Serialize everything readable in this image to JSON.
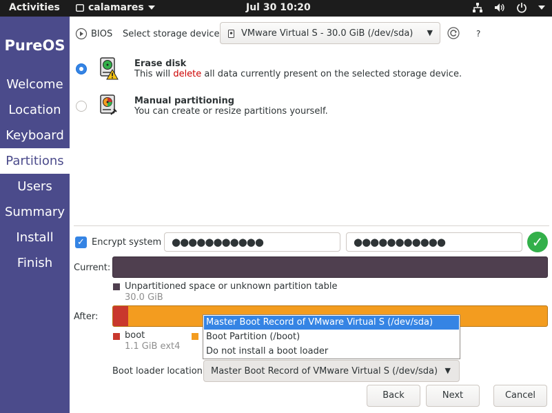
{
  "topbar": {
    "activities": "Activities",
    "app_name": "calamares",
    "clock": "Jul 30  10:20",
    "icons": [
      "network-icon",
      "volume-icon",
      "power-icon",
      "chevron-down-icon"
    ]
  },
  "sidebar": {
    "logo": "PureOS",
    "steps": [
      {
        "label": "Welcome"
      },
      {
        "label": "Location"
      },
      {
        "label": "Keyboard"
      },
      {
        "label": "Partitions",
        "active": true
      },
      {
        "label": "Users"
      },
      {
        "label": "Summary"
      },
      {
        "label": "Install"
      },
      {
        "label": "Finish"
      }
    ]
  },
  "device": {
    "firmware": "BIOS",
    "label": "Select storage device:",
    "selected": "VMware Virtual S - 30.0 GiB (/dev/sda)",
    "help": "?"
  },
  "options": {
    "erase": {
      "title": "Erase disk",
      "desc_pre": "This will ",
      "desc_red": "delete",
      "desc_post": " all data currently present on the selected storage device.",
      "selected": true
    },
    "manual": {
      "title": "Manual partitioning",
      "desc": "You can create or resize partitions yourself.",
      "selected": false
    }
  },
  "encrypt": {
    "label": "Encrypt system",
    "checked": true,
    "password": "●●●●●●●●●●●",
    "confirm": "●●●●●●●●●●●"
  },
  "current": {
    "label": "Current:",
    "legend_label": "Unpartitioned space or unknown partition table",
    "legend_size": "30.0 GiB",
    "color": "#4f3f4f"
  },
  "after": {
    "label": "After:",
    "boot_label": "boot",
    "boot_size": "1.1 GiB  ext4",
    "boot_color": "#c9382d",
    "root_color": "#f39c1f"
  },
  "bootloader": {
    "label": "Boot loader location:",
    "selected": "Master Boot Record of VMware Virtual S (/dev/sda)",
    "options": [
      "Master Boot Record of VMware Virtual S (/dev/sda)",
      "Boot Partition (/boot)",
      "Do not install a boot loader"
    ]
  },
  "buttons": {
    "back": "Back",
    "next": "Next",
    "cancel": "Cancel"
  },
  "colors": {
    "sidebar": "#4b4b8b",
    "accent": "#3584e4",
    "danger": "#cc0000",
    "success": "#33b04a"
  }
}
